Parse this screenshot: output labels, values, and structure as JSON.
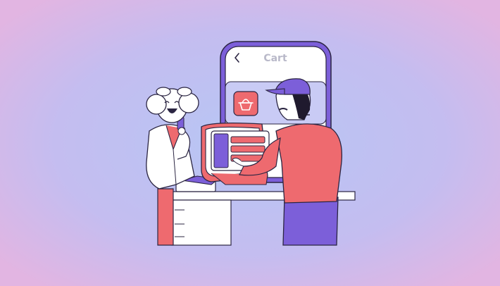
{
  "phone": {
    "title": "Cart",
    "back_icon": "chevron-left-icon",
    "basket_icon": "shopping-basket-icon"
  },
  "colors": {
    "bg_left": "#e3b6e3",
    "bg_center": "#b9c4f2",
    "phone_frame": "#7c5fd9",
    "phone_screen": "#ffffff",
    "accent_red": "#ee6a6f",
    "purple": "#7c5fd9",
    "outline": "#2b2542"
  }
}
